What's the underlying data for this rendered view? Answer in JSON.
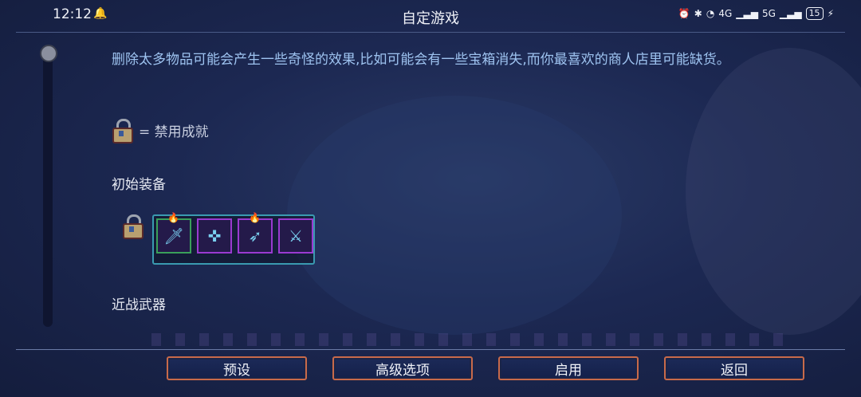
{
  "status_bar": {
    "time": "12:12",
    "network": "4G",
    "network2": "5G",
    "battery": "15"
  },
  "header": {
    "title": "自定游戏"
  },
  "main": {
    "warning_text": "删除太多物品可能会产生一些奇怪的效果,比如可能会有一些宝箱消失,而你最喜欢的商人店里可能缺货。",
    "lock_legend": "= 禁用成就",
    "starting_gear_title": "初始装备",
    "melee_weapons_title": "近战武器",
    "slots": [
      {
        "icon": "🗡",
        "flame": "🔥"
      },
      {
        "icon": "✜",
        "flame": ""
      },
      {
        "icon": "➶",
        "flame": "🔥"
      },
      {
        "icon": "⚔",
        "flame": ""
      }
    ]
  },
  "footer": {
    "preset_label": "预设",
    "advanced_label": "高级选项",
    "enable_label": "启用",
    "back_label": "返回"
  },
  "colors": {
    "accent": "#c86a4a",
    "text_blue": "#9ec3f0",
    "slot_border": "#9a3ad0"
  }
}
